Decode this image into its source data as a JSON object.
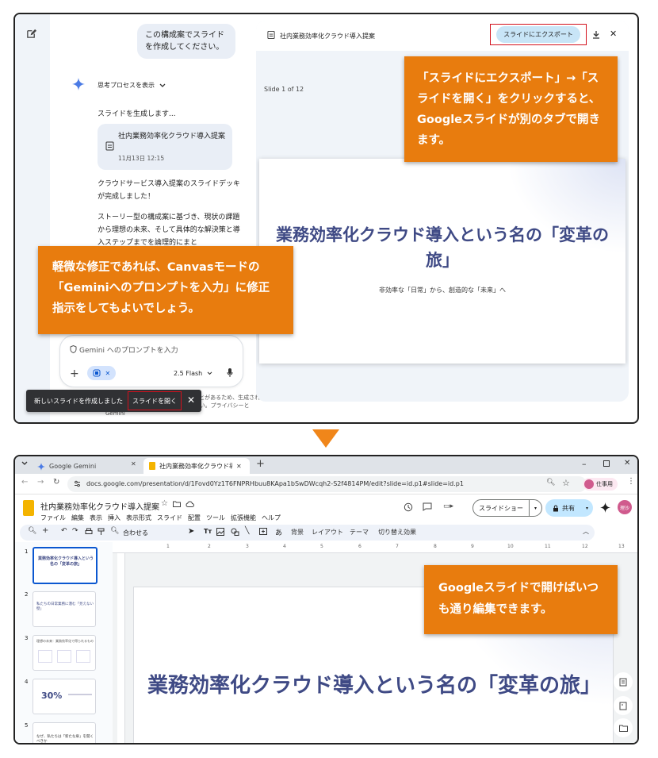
{
  "gemini": {
    "user_message": "この構成案でスライドを作成してください。",
    "thinking_label": "思考プロセスを表示",
    "generating": "スライドを生成します...",
    "doc_card_title": "社内業務効率化クラウド導入提案",
    "doc_card_date": "11月13日 12:15",
    "reply1": "クラウドサービス導入提案のスライドデッキが完成しました！",
    "reply2": "ストーリー型の構成案に基づき、現状の課題から理想の未来、そして具体的な解決策と導入ステップまでを論理的にまと",
    "prompt_placeholder": "Gemini へのプロンプトを入力",
    "model_label": "2.5 Flash",
    "disclaimer": "Gemini は不正確な情報を表示することがあるため、生成された回答を再確認するようにしてください。プライバシーと Gemini",
    "toast_text": "新しいスライドを作成しました",
    "toast_action": "スライドを開く",
    "canvas_title": "社内業務効率化クラウド導入提案",
    "export_button": "スライドにエクスポート",
    "slide_counter": "Slide 1 of 12",
    "slide_title": "業務効率化クラウド導入という名の「変革の旅」",
    "slide_subtitle": "非効率な「日常」から、創造的な「未来」へ"
  },
  "callouts": {
    "c1": "「スライドにエクスポート」→「スライドを開く」をクリックすると、Googleスライドが別のタブで開きます。",
    "c2": "軽微な修正であれば、Canvasモードの「Geminiへのプロンプトを入力」に修正指示をしてもよいでしょう。",
    "c3": "Googleスライドで開けばいつも通り編集できます。"
  },
  "browser": {
    "tab1": "Google Gemini",
    "tab2": "社内業務効率化クラウド導入提",
    "url": "docs.google.com/presentation/d/1Fovd0Yz1T6FNPRHbuu8KApa1bSwDWcqh2-S2f4814PM/edit?slide=id.p1#slide=id.p1",
    "profile": "仕事用"
  },
  "slides": {
    "doc_title": "社内業務効率化クラウド導入提案",
    "menus": [
      "ファイル",
      "編集",
      "表示",
      "挿入",
      "表示形式",
      "スライド",
      "配置",
      "ツール",
      "拡張機能",
      "ヘルプ"
    ],
    "slideshow": "スライドショー",
    "share": "共有",
    "avatar": "理沙",
    "fit": "合わせる",
    "tool_labels": [
      "背景",
      "レイアウト",
      "テーマ",
      "切り替え効果"
    ],
    "ruler": [
      "1",
      "2",
      "3",
      "4",
      "5",
      "6",
      "7",
      "8",
      "9",
      "10",
      "11",
      "12",
      "13"
    ],
    "thumbs": [
      "1",
      "2",
      "3",
      "4",
      "5"
    ],
    "thumb1_text": "業務効率化クラウド導入という名の「変革の旅」",
    "thumb2_text": "私たちの日常業務に潜む「見えない壁」",
    "thumb3_text": "理想の未来：業務効率化で得られるもの",
    "thumb4_big": "30%",
    "thumb5_text": "なぜ、私たちは「新たな扉」を開くべきか",
    "slide_title": "業務効率化クラウド導入という名の「変革の旅」"
  }
}
